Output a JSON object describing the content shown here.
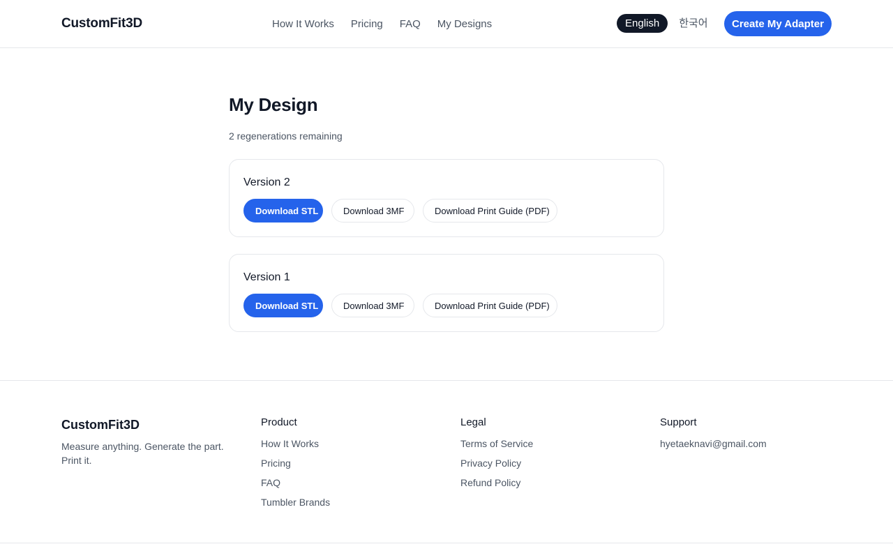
{
  "header": {
    "logo": "CustomFit3D",
    "nav": [
      "How It Works",
      "Pricing",
      "FAQ",
      "My Designs"
    ],
    "languages": {
      "english": "English",
      "korean": "한국어"
    },
    "active_language": "English",
    "cta_label": "Create My Adapter"
  },
  "main": {
    "title": "My Design",
    "remaining": "2 regenerations remaining",
    "versions": [
      {
        "title": "Version 2",
        "actions": {
          "stl": "Download STL",
          "threemf": "Download 3MF",
          "pdf": "Download Print Guide (PDF)"
        }
      },
      {
        "title": "Version 1",
        "actions": {
          "stl": "Download STL",
          "threemf": "Download 3MF",
          "pdf": "Download Print Guide (PDF)"
        }
      }
    ]
  },
  "footer": {
    "logo": "CustomFit3D",
    "tagline": "Measure anything. Generate the part. Print it.",
    "product": {
      "heading": "Product",
      "links": [
        "How It Works",
        "Pricing",
        "FAQ",
        "Tumbler Brands"
      ]
    },
    "legal": {
      "heading": "Legal",
      "links": [
        "Terms of Service",
        "Privacy Policy",
        "Refund Policy"
      ]
    },
    "support": {
      "heading": "Support",
      "email": "hyetaeknavi@gmail.com"
    }
  },
  "colors": {
    "accent": "#2563eb",
    "text": "#111827",
    "muted": "#4b5563",
    "border": "#e5e7eb"
  }
}
